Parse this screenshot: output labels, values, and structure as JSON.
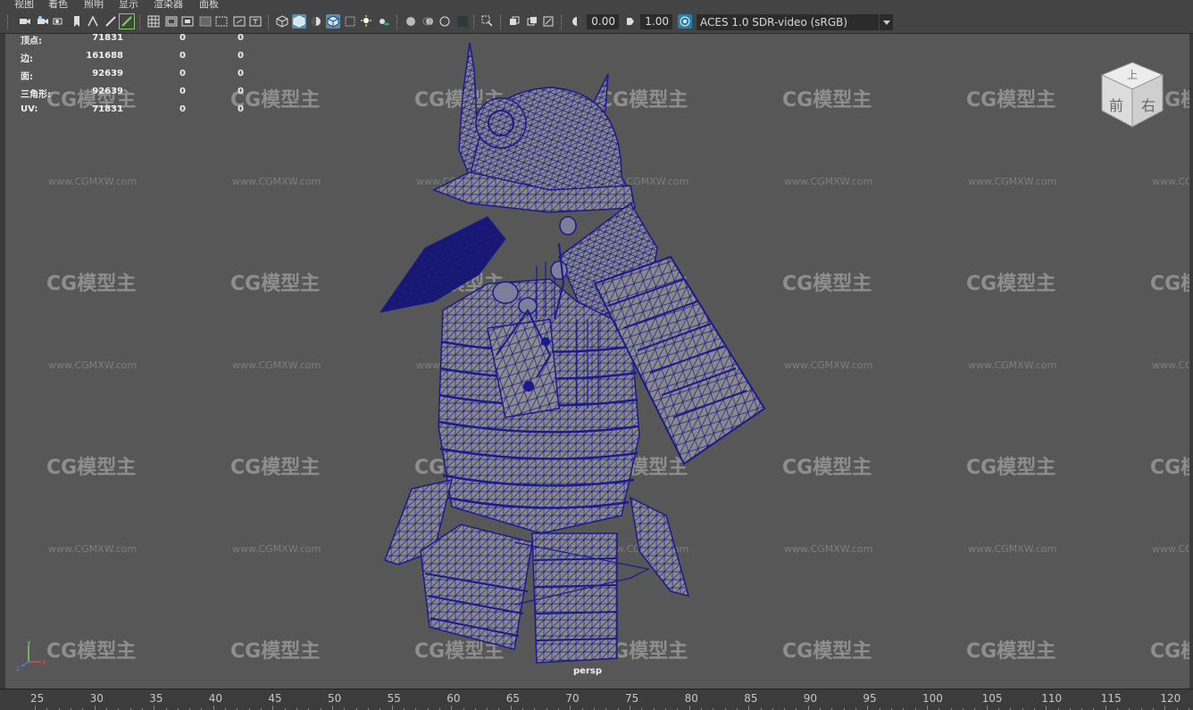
{
  "menu": {
    "items": [
      "视图",
      "着色",
      "照明",
      "显示",
      "渲染器",
      "面板"
    ]
  },
  "toolbar": {
    "exposure_value": "0.00",
    "gamma_value": "1.00",
    "color_space": "ACES 1.0 SDR-video (sRGB)"
  },
  "hud": {
    "rows": [
      {
        "label": "顶点:",
        "total": "71831",
        "selected": "0",
        "other": "0"
      },
      {
        "label": "边:",
        "total": "161688",
        "selected": "0",
        "other": "0"
      },
      {
        "label": "面:",
        "total": "92639",
        "selected": "0",
        "other": "0"
      },
      {
        "label": "三角形:",
        "total": "92639",
        "selected": "0",
        "other": "0"
      },
      {
        "label": "UV:",
        "total": "71831",
        "selected": "0",
        "other": "0"
      }
    ]
  },
  "viewport": {
    "camera_label": "persp",
    "background_color": "#575757",
    "wire_color": "#1a1a8c"
  },
  "viewcube": {
    "top_label": "上",
    "front_label": "前",
    "right_label": "右"
  },
  "watermark": {
    "logo_text": "CG模型主",
    "url_text": "www.CGMXW.com"
  },
  "axis": {
    "x": "x",
    "y": "y",
    "z": "z"
  },
  "timeline": {
    "ticks": [
      "25",
      "30",
      "35",
      "40",
      "45",
      "50",
      "55",
      "60",
      "65",
      "70",
      "75",
      "80",
      "85",
      "90",
      "95",
      "100",
      "105",
      "110",
      "115",
      "120"
    ]
  }
}
